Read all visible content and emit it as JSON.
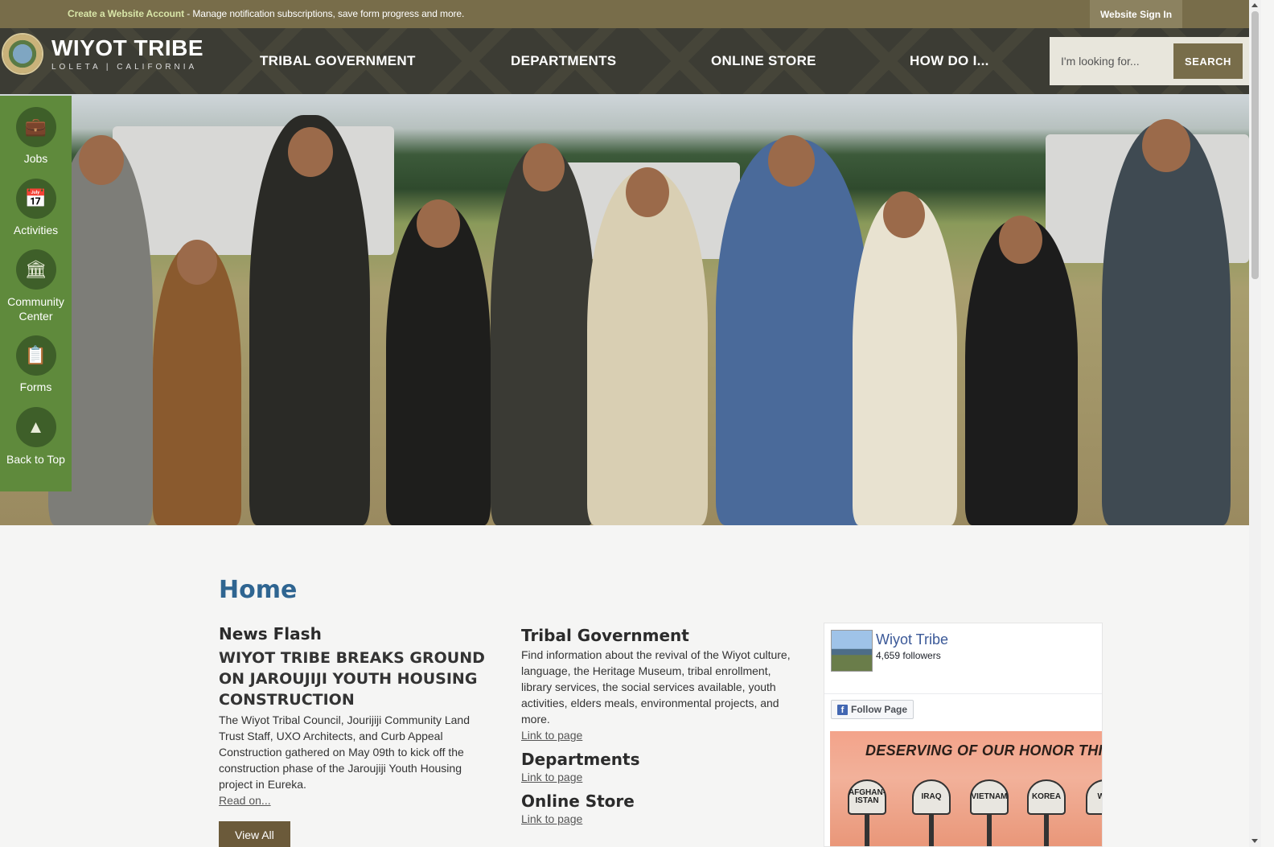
{
  "topbar": {
    "promo_link": "Create a Website Account",
    "promo_text": " - Manage notification subscriptions, save form progress and more.",
    "sign_in": "Website Sign In"
  },
  "header": {
    "logo_title": "WIYOT TRIBE",
    "logo_subtitle": "LOLETA | CALIFORNIA",
    "nav": [
      "TRIBAL GOVERNMENT",
      "DEPARTMENTS",
      "ONLINE STORE",
      "HOW DO I..."
    ],
    "search_placeholder": "I'm looking for...",
    "search_button": "SEARCH"
  },
  "quick_links": [
    {
      "label": "Jobs",
      "icon": "briefcase-icon"
    },
    {
      "label": "Activities",
      "icon": "calendar-icon"
    },
    {
      "label": "Community Center",
      "icon": "building-icon"
    },
    {
      "label": "Forms",
      "icon": "clipboard-icon"
    },
    {
      "label": "Back to Top",
      "icon": "arrow-up-icon"
    }
  ],
  "main": {
    "title": "Home",
    "news": {
      "section_title": "News Flash",
      "headline": "WIYOT TRIBE BREAKS GROUND ON JAROUJIJI YOUTH HOUSING CONSTRUCTION",
      "body": "The Wiyot Tribal Council, Jourijiji Community Land Trust Staff, UXO Architects, and Curb Appeal Construction gathered on May 09th to kick off the construction phase of the Jaroujiji Youth Housing project in Eureka.",
      "read_on": "Read on...",
      "view_all": "View All"
    },
    "sections": [
      {
        "title": "Tribal Government",
        "body": "Find information about the revival of the Wiyot culture, language, the Heritage Museum, tribal enrollment, library services, the social services available, youth activities, elders meals, environmental projects, and more.",
        "link": "Link to page"
      },
      {
        "title": "Departments",
        "link": "Link to page"
      },
      {
        "title": "Online Store",
        "link": "Link to page"
      }
    ]
  },
  "facebook": {
    "page_name": "Wiyot Tribe",
    "followers": "4,659 followers",
    "follow_button": "Follow Page",
    "post_title": "DESERVING OF OUR HONOR THIS MEMO",
    "helmets": [
      "AFGHAN-ISTAN",
      "IRAQ",
      "VIETNAM",
      "KOREA",
      "WW"
    ]
  }
}
